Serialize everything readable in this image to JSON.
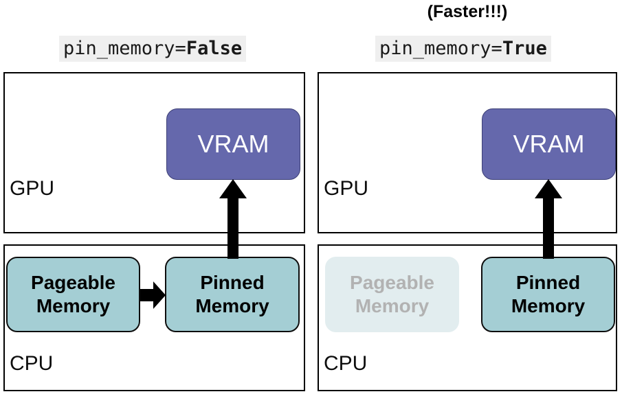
{
  "diagram": {
    "title_note": "(Faster!!!)",
    "panels": [
      {
        "id": "left",
        "title_prefix": "pin_memory=",
        "title_value": "False",
        "gpu_label": "GPU",
        "cpu_label": "CPU",
        "vram_label": "VRAM",
        "pageable_line1": "Pageable",
        "pageable_line2": "Memory",
        "pinned_line1": "Pinned",
        "pinned_line2": "Memory"
      },
      {
        "id": "right",
        "title_prefix": "pin_memory=",
        "title_value": "True",
        "gpu_label": "GPU",
        "cpu_label": "CPU",
        "vram_label": "VRAM",
        "pageable_line1": "Pageable",
        "pageable_line2": "Memory",
        "pinned_line1": "Pinned",
        "pinned_line2": "Memory"
      }
    ],
    "colors": {
      "vram_fill": "#6568ac",
      "memory_fill": "#a4ced4",
      "memory_faded_fill": "#e2edef",
      "memory_faded_text": "#b2b2b2",
      "arrow": "#000000",
      "title_background": "#efefef",
      "panel_border": "#000000"
    },
    "icons": {
      "transfer_arrow_up": "arrow-up-icon",
      "transfer_arrow_right": "arrow-right-icon"
    }
  }
}
